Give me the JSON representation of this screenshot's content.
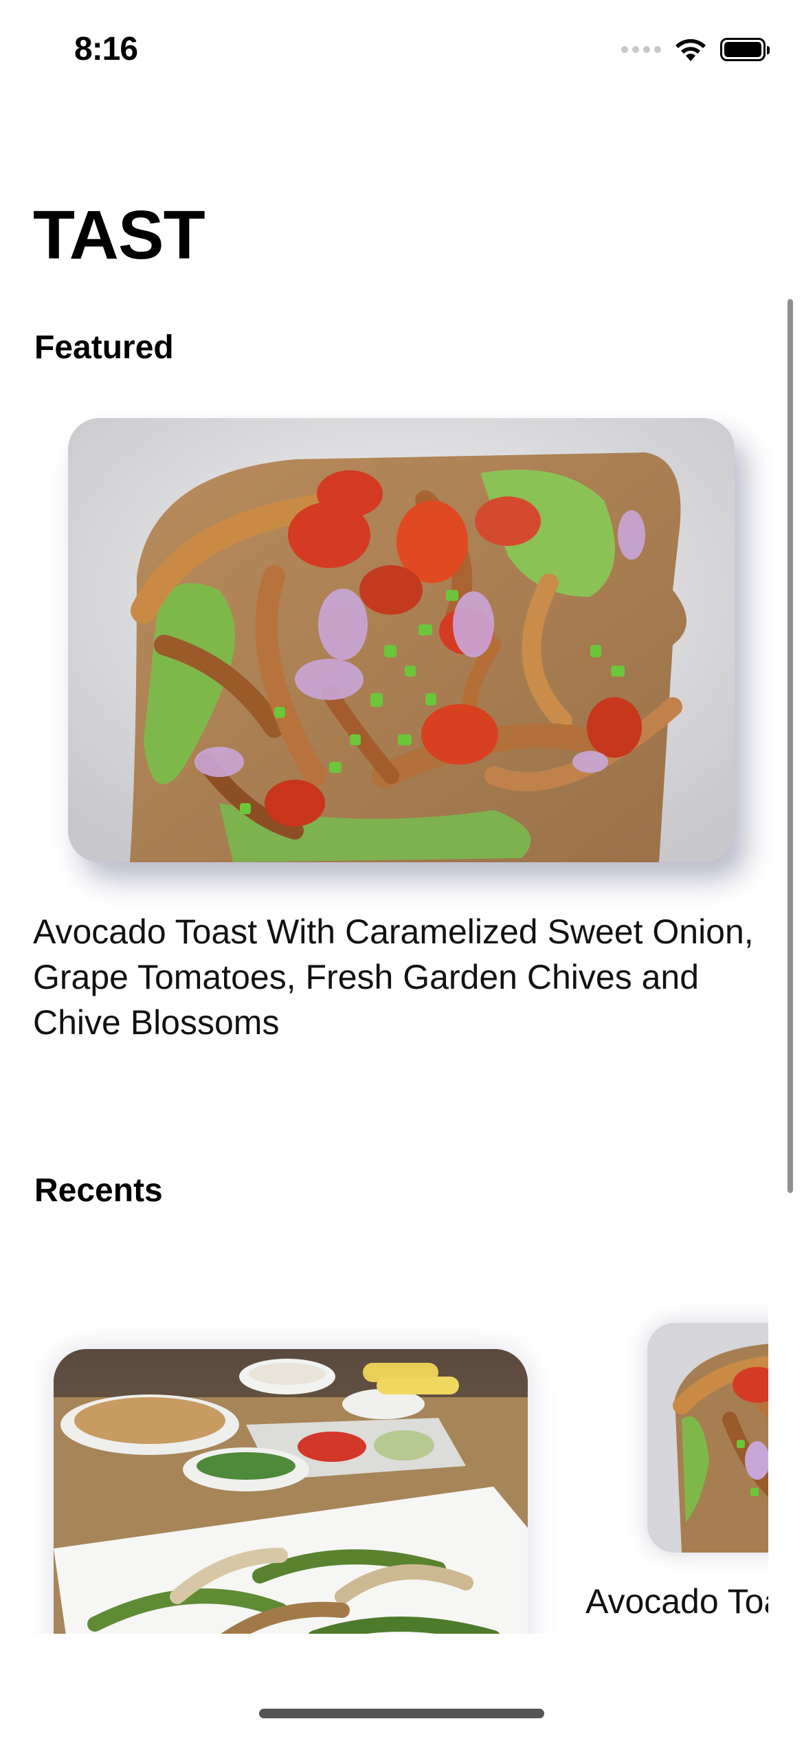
{
  "status_bar": {
    "time": "8:16",
    "icons": [
      "cellular-signal-icon",
      "wifi-icon",
      "battery-icon"
    ]
  },
  "app": {
    "title": "TAST"
  },
  "featured": {
    "section_title": "Featured",
    "card": {
      "image": "avocado-toast-photo",
      "caption": "Avocado Toast With Caramelized Sweet Onion, Grape Tomatoes, Fresh Garden Chives and Chive Blossoms"
    }
  },
  "recents": {
    "section_title": "Recents",
    "items": [
      {
        "image": "fajitas-table-photo",
        "caption": ""
      },
      {
        "image": "avocado-toast-photo",
        "caption": "Avocado Toa"
      }
    ]
  },
  "colors": {
    "background": "#ffffff",
    "text": "#000000",
    "card_shadow": "#3c3c6e"
  }
}
